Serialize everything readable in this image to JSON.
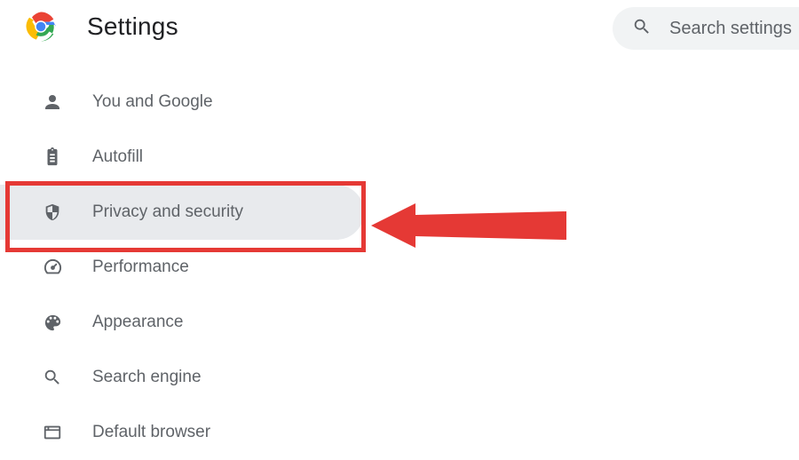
{
  "header": {
    "title": "Settings"
  },
  "search": {
    "placeholder": "Search settings"
  },
  "sidebar": {
    "items": [
      {
        "label": "You and Google",
        "icon": "person"
      },
      {
        "label": "Autofill",
        "icon": "clipboard"
      },
      {
        "label": "Privacy and security",
        "icon": "shield"
      },
      {
        "label": "Performance",
        "icon": "speedometer"
      },
      {
        "label": "Appearance",
        "icon": "palette"
      },
      {
        "label": "Search engine",
        "icon": "magnifier"
      },
      {
        "label": "Default browser",
        "icon": "browser"
      }
    ],
    "selected_index": 2
  },
  "annotation": {
    "highlight_color": "#e53935",
    "arrow_color": "#e53935"
  }
}
